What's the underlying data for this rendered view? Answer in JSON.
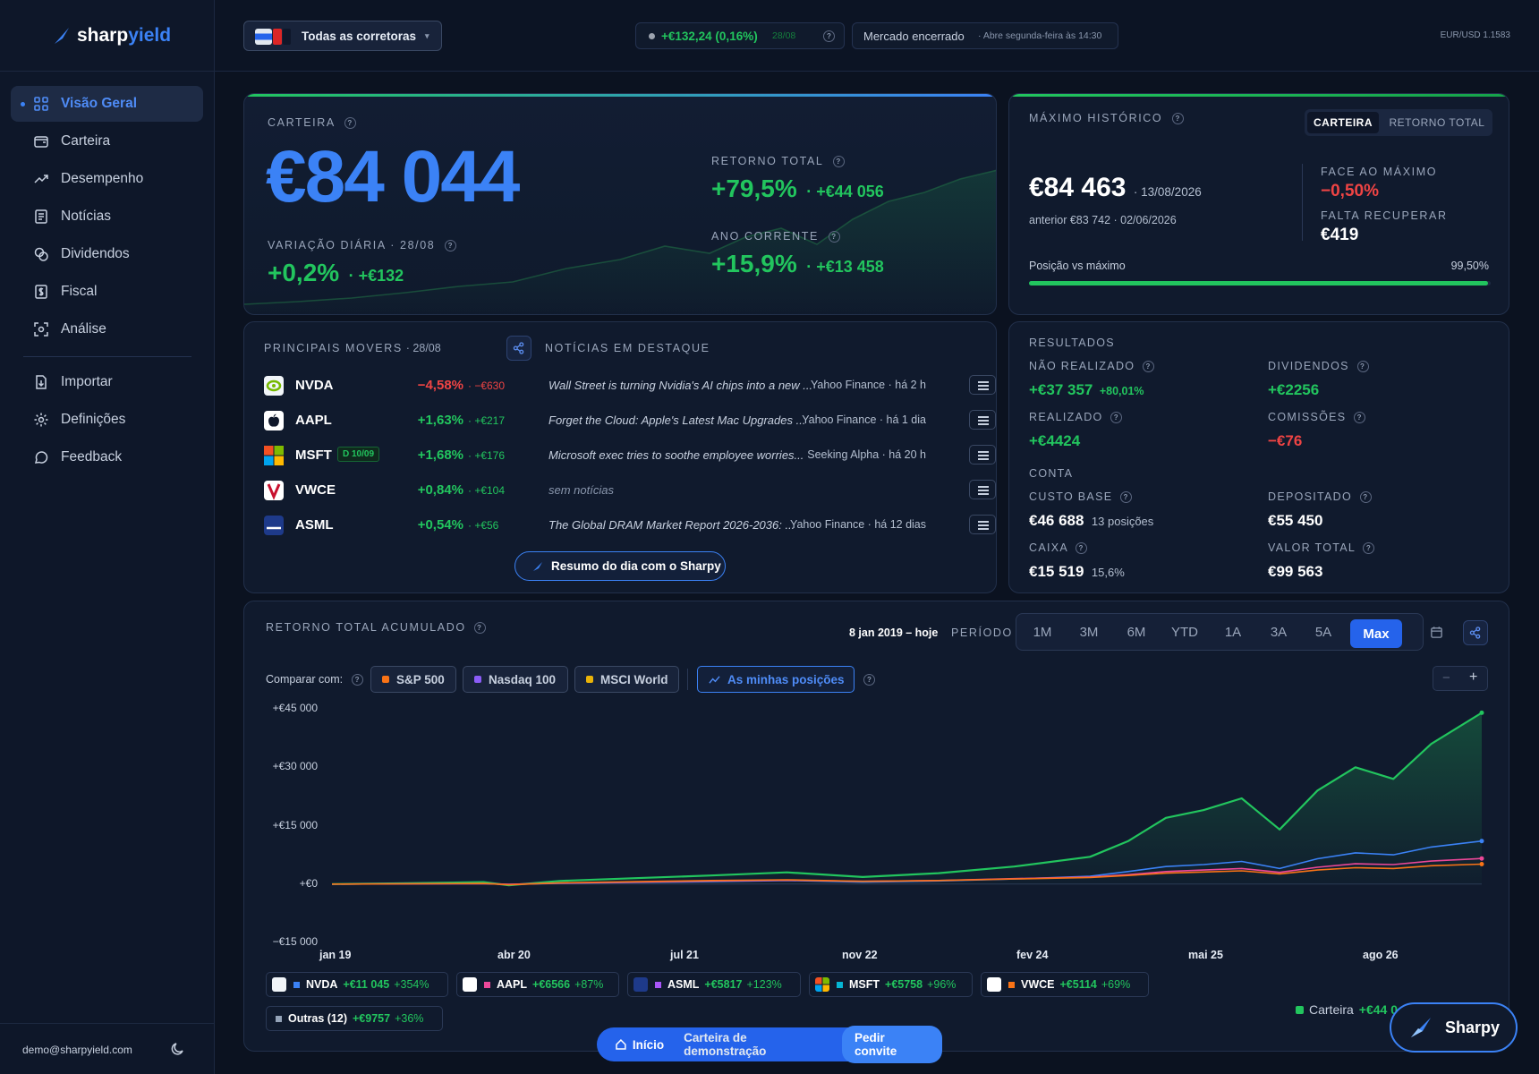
{
  "app": {
    "brand_part1": "sharp",
    "brand_part2": "yield"
  },
  "sidebar": {
    "items": [
      {
        "label": "Visão Geral",
        "icon": "grid-icon"
      },
      {
        "label": "Carteira",
        "icon": "wallet-icon"
      },
      {
        "label": "Desempenho",
        "icon": "trend-icon"
      },
      {
        "label": "Notícias",
        "icon": "newspaper-icon"
      },
      {
        "label": "Dividendos",
        "icon": "coins-icon"
      },
      {
        "label": "Fiscal",
        "icon": "tax-icon"
      },
      {
        "label": "Análise",
        "icon": "scan-icon"
      },
      {
        "label": "Importar",
        "icon": "import-icon"
      },
      {
        "label": "Definições",
        "icon": "gear-icon"
      },
      {
        "label": "Feedback",
        "icon": "chat-icon"
      }
    ],
    "user_email": "demo@sharpyield.com"
  },
  "topbar": {
    "broker_label": "Todas as corretoras",
    "day_change": "+€132,24 (0,16%)",
    "day_date": "28/08",
    "market_status": "Mercado encerrado",
    "market_next": "· Abre segunda-feira às 14:30",
    "fx": "EUR/USD 1.1583"
  },
  "portfolio": {
    "caption": "CARTEIRA",
    "value": "€84 044",
    "daily_caption": "VARIAÇÃO DIÁRIA · 28/08",
    "daily_pct": "+0,2%",
    "daily_abs": "· +€132",
    "total_caption": "RETORNO TOTAL",
    "total_pct": "+79,5%",
    "total_abs": "· +€44 056",
    "ytd_caption": "ANO CORRENTE",
    "ytd_pct": "+15,9%",
    "ytd_abs": "· +€13 458"
  },
  "ath": {
    "caption": "MÁXIMO HISTÓRICO",
    "toggle_a": "CARTEIRA",
    "toggle_b": "RETORNO TOTAL",
    "value": "€84 463",
    "date": "· 13/08/2026",
    "previous": "anterior €83 742 · 02/06/2026",
    "vs_caption": "FACE AO MÁXIMO",
    "vs_value": "−0,50%",
    "recover_caption": "FALTA RECUPERAR",
    "recover_value": "€419",
    "position_label": "Posição vs máximo",
    "position_value": "99,50%",
    "position_fraction": 0.995
  },
  "movers": {
    "caption": "PRINCIPAIS MOVERS",
    "date": "· 28/08",
    "news_caption": "NOTÍCIAS EM DESTAQUE",
    "rows": [
      {
        "ticker": "NVDA",
        "pct": "−4,58%",
        "abs": "· −€630",
        "dir": "down",
        "news": "Wall Street is turning Nvidia's AI chips into a new ...",
        "source": "Yahoo Finance · há 2 h",
        "badge": ""
      },
      {
        "ticker": "AAPL",
        "pct": "+1,63%",
        "abs": "· +€217",
        "dir": "up",
        "news": "Forget the Cloud: Apple's Latest Mac Upgrades ...",
        "source": "Yahoo Finance · há 1 dia",
        "badge": ""
      },
      {
        "ticker": "MSFT",
        "pct": "+1,68%",
        "abs": "· +€176",
        "dir": "up",
        "news": "Microsoft exec tries to soothe employee worries...",
        "source": "Seeking Alpha · há 20 h",
        "badge": "D 10/09"
      },
      {
        "ticker": "VWCE",
        "pct": "+0,84%",
        "abs": "· +€104",
        "dir": "up",
        "news": "sem notícias",
        "source": "",
        "badge": ""
      },
      {
        "ticker": "ASML",
        "pct": "+0,54%",
        "abs": "· +€56",
        "dir": "up",
        "news": "The Global DRAM Market Report 2026-2036: ...",
        "source": "Yahoo Finance · há 12 dias",
        "badge": ""
      }
    ],
    "summary_button": "Resumo do dia com o Sharpy"
  },
  "results": {
    "caption": "RESULTADOS",
    "unrealized_caption": "NÃO REALIZADO",
    "unrealized_value": "+€37 357",
    "unrealized_pct": "+80,01%",
    "dividends_caption": "DIVIDENDOS",
    "dividends_value": "+€2256",
    "realized_caption": "REALIZADO",
    "realized_value": "+€4424",
    "fees_caption": "COMISSÕES",
    "fees_value": "−€76",
    "account_caption": "CONTA",
    "cost_caption": "CUSTO BASE",
    "cost_value": "€46 688",
    "cost_extra": "13 posições",
    "deposited_caption": "DEPOSITADO",
    "deposited_value": "€55 450",
    "cash_caption": "CAIXA",
    "cash_value": "€15 519",
    "cash_extra": "15,6%",
    "total_caption": "VALOR TOTAL",
    "total_value": "€99 563"
  },
  "chart_section": {
    "caption": "RETORNO TOTAL ACUMULADO",
    "range": "8 jan 2019 – hoje",
    "period_caption": "PERÍODO",
    "periods": [
      "1M",
      "3M",
      "6M",
      "YTD",
      "1A",
      "3A",
      "5A",
      "Max"
    ],
    "active_period": "Max",
    "compare_label": "Comparar com:",
    "compare": [
      {
        "label": "S&P 500",
        "color": "#f97316"
      },
      {
        "label": "Nasdaq 100",
        "color": "#8b5cf6"
      },
      {
        "label": "MSCI World",
        "color": "#eab308"
      }
    ],
    "positions_button": "As minhas posições",
    "legend": [
      {
        "ticker": "NVDA",
        "value": "+€11 045",
        "pct": "+354%",
        "color": "#3b82f6"
      },
      {
        "ticker": "AAPL",
        "value": "+€6566",
        "pct": "+87%",
        "color": "#ec4899"
      },
      {
        "ticker": "ASML",
        "value": "+€5817",
        "pct": "+123%",
        "color": "#a855f7"
      },
      {
        "ticker": "MSFT",
        "value": "+€5758",
        "pct": "+96%",
        "color": "#06b6d4"
      },
      {
        "ticker": "VWCE",
        "value": "+€5114",
        "pct": "+69%",
        "color": "#f97316"
      },
      {
        "ticker": "Outras (12)",
        "value": "+€9757",
        "pct": "+36%",
        "color": "#94a3b8"
      }
    ],
    "carteira_legend": "Carteira",
    "carteira_value": "+€44 0"
  },
  "chart_data": {
    "type": "line",
    "ylabel": "",
    "xlabel": "",
    "ylim": [
      -15000,
      45000
    ],
    "y_ticks": [
      "+€45 000",
      "+€30 000",
      "+€15 000",
      "+€0",
      "−€15 000"
    ],
    "x_ticks": [
      "jan 19",
      "abr 20",
      "jul 21",
      "nov 22",
      "fev 24",
      "mai 25",
      "ago 26"
    ],
    "x": [
      "2019-01",
      "2019-07",
      "2020-01",
      "2020-03",
      "2020-07",
      "2021-01",
      "2021-07",
      "2022-01",
      "2022-07",
      "2023-01",
      "2023-07",
      "2024-01",
      "2024-04",
      "2024-07",
      "2024-10",
      "2025-01",
      "2025-04",
      "2025-07",
      "2025-10",
      "2026-01",
      "2026-04",
      "2026-08"
    ],
    "series": [
      {
        "name": "Carteira",
        "color": "#22c55e",
        "values": [
          0,
          200,
          500,
          -300,
          800,
          1500,
          2200,
          3000,
          1800,
          2800,
          4500,
          7000,
          11000,
          17000,
          19000,
          22000,
          14000,
          24000,
          30000,
          27000,
          36000,
          44000
        ]
      },
      {
        "name": "NVDA",
        "color": "#3b82f6",
        "values": [
          0,
          50,
          100,
          -100,
          200,
          400,
          600,
          900,
          500,
          800,
          1300,
          2000,
          3200,
          4500,
          5000,
          5800,
          4000,
          6500,
          8000,
          7500,
          9500,
          11045
        ]
      },
      {
        "name": "AAPL",
        "color": "#ec4899",
        "values": [
          0,
          40,
          100,
          -80,
          250,
          500,
          800,
          1000,
          700,
          900,
          1400,
          1800,
          2400,
          3200,
          3600,
          4000,
          3000,
          4300,
          5200,
          5000,
          5900,
          6566
        ]
      },
      {
        "name": "S&P 500",
        "color": "#f97316",
        "values": [
          0,
          60,
          150,
          -200,
          300,
          600,
          900,
          1100,
          700,
          900,
          1300,
          1700,
          2200,
          2800,
          3100,
          3400,
          2600,
          3600,
          4200,
          4000,
          4700,
          5114
        ]
      }
    ]
  }
}
